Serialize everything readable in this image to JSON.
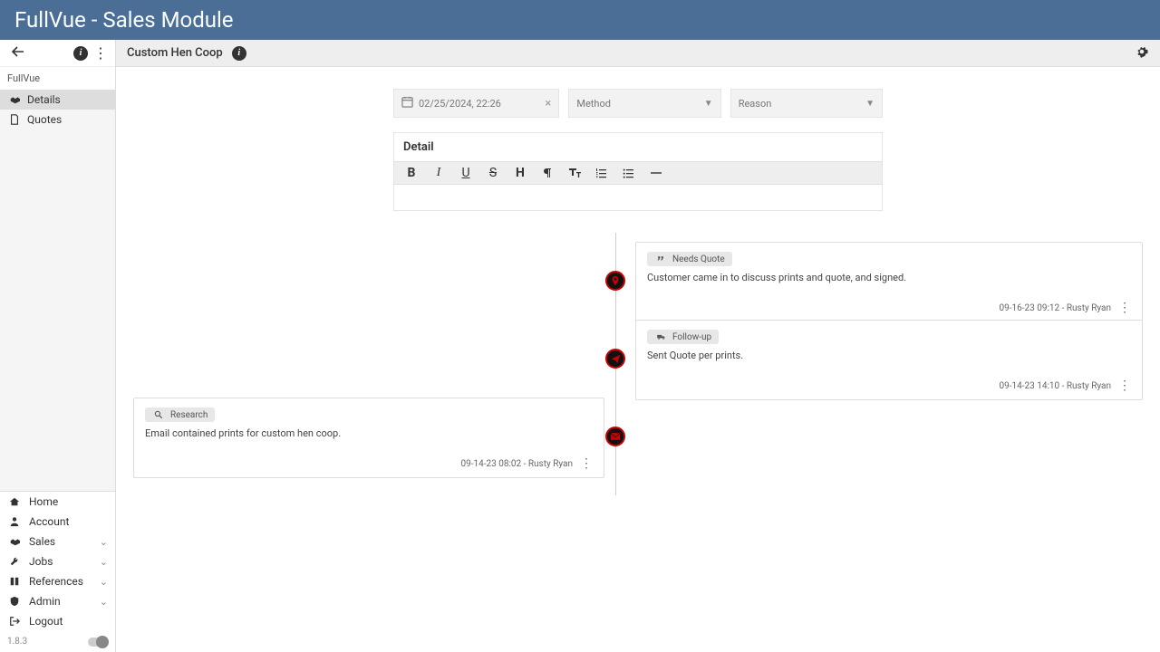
{
  "app": {
    "title": "FullVue - Sales Module"
  },
  "sidebar": {
    "breadcrumb": "FullVue",
    "items": [
      {
        "label": "Details",
        "active": true
      },
      {
        "label": "Quotes",
        "active": false
      }
    ],
    "bottom": [
      {
        "label": "Home",
        "expandable": false
      },
      {
        "label": "Account",
        "expandable": false
      },
      {
        "label": "Sales",
        "expandable": true
      },
      {
        "label": "Jobs",
        "expandable": true
      },
      {
        "label": "References",
        "expandable": true
      },
      {
        "label": "Admin",
        "expandable": true
      },
      {
        "label": "Logout",
        "expandable": false
      }
    ],
    "version": "1.8.3"
  },
  "page": {
    "title": "Custom Hen Coop"
  },
  "form": {
    "date_value": "02/25/2024, 22:26",
    "method_placeholder": "Method",
    "reason_placeholder": "Reason"
  },
  "editor": {
    "heading": "Detail"
  },
  "timeline": [
    {
      "side": "right",
      "icon": "pin",
      "chip_icon": "quote",
      "chip_label": "Needs Quote",
      "body": "Customer came in to discuss prints and quote, and signed.",
      "meta": "09-16-23 09:12 - Rusty Ryan"
    },
    {
      "side": "right",
      "icon": "send",
      "chip_icon": "truck",
      "chip_label": "Follow-up",
      "body": "Sent Quote per prints.",
      "meta": "09-14-23 14:10 - Rusty Ryan"
    },
    {
      "side": "left",
      "icon": "mail",
      "chip_icon": "search",
      "chip_label": "Research",
      "body": "Email contained prints for custom hen coop.",
      "meta": "09-14-23 08:02 - Rusty Ryan"
    }
  ]
}
